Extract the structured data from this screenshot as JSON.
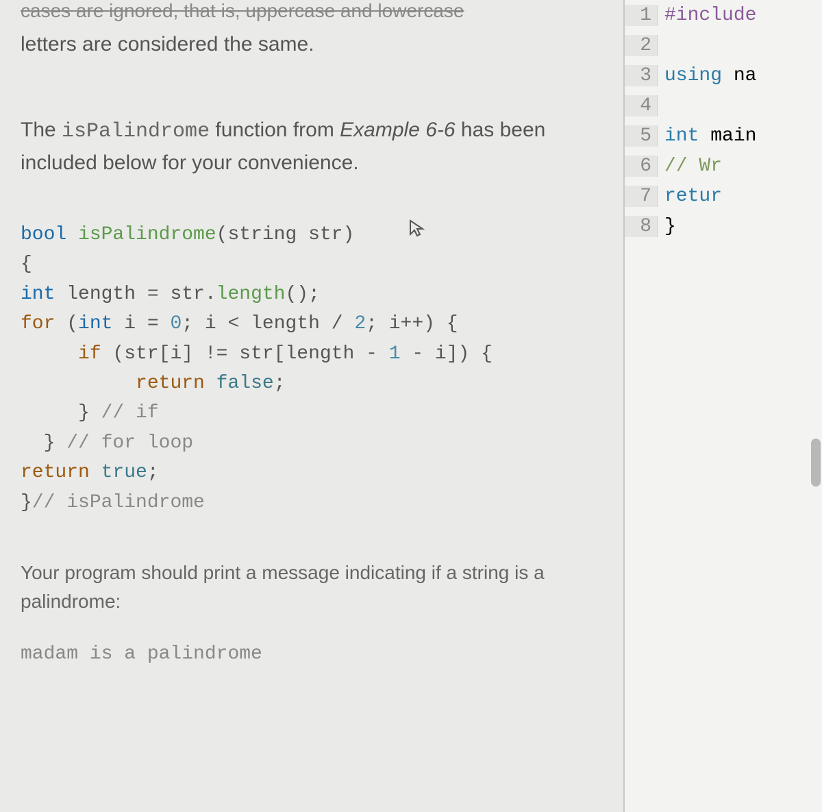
{
  "left": {
    "strikethrough": "cases are ignored, that is, uppercase and lowercase",
    "line1": "letters are considered the same.",
    "para2_pre": "The ",
    "para2_code": "isPalindrome",
    "para2_mid": " function from ",
    "para2_italic": "Example 6-6",
    "para2_post": " has been included below for your convenience.",
    "code": {
      "l1_type": "bool",
      "l1_fn": " isPalindrome",
      "l1_rest": "(string str)",
      "l2": "{",
      "l3_type": "int",
      "l3_a": " length = str.",
      "l3_fn": "length",
      "l3_b": "();",
      "l4_kw": "for",
      "l4_a": " (",
      "l4_type": "int",
      "l4_b": " i = ",
      "l4_num0": "0",
      "l4_c": "; i < length / ",
      "l4_num2": "2",
      "l4_d": "; i++) {",
      "l5_kw": "if",
      "l5_a": " (str[i] != str[length - ",
      "l5_num1": "1",
      "l5_b": " - i]) {",
      "l6_kw": "return",
      "l6_val": " false",
      "l6_b": ";",
      "l7_a": "} ",
      "l7_com": "// if",
      "l8_a": "} ",
      "l8_com": "// for loop",
      "l9_kw": "return",
      "l9_val": " true",
      "l9_b": ";",
      "l10_a": "}",
      "l10_com": "// isPalindrome"
    },
    "para3": "Your program should print a message indicating if a string is a palindrome:",
    "output": "madam is a palindrome"
  },
  "right": {
    "lines": [
      {
        "n": "1",
        "pre": "#include",
        "rest": ""
      },
      {
        "n": "2",
        "rest": ""
      },
      {
        "n": "3",
        "kw": "using",
        "rest": " na"
      },
      {
        "n": "4",
        "rest": ""
      },
      {
        "n": "5",
        "kw": "int",
        "rest2": " main"
      },
      {
        "n": "6",
        "indent": "    ",
        "com": "// Wr"
      },
      {
        "n": "7",
        "indent": "    ",
        "kw2": "retur"
      },
      {
        "n": "8",
        "rest": "}"
      }
    ]
  }
}
